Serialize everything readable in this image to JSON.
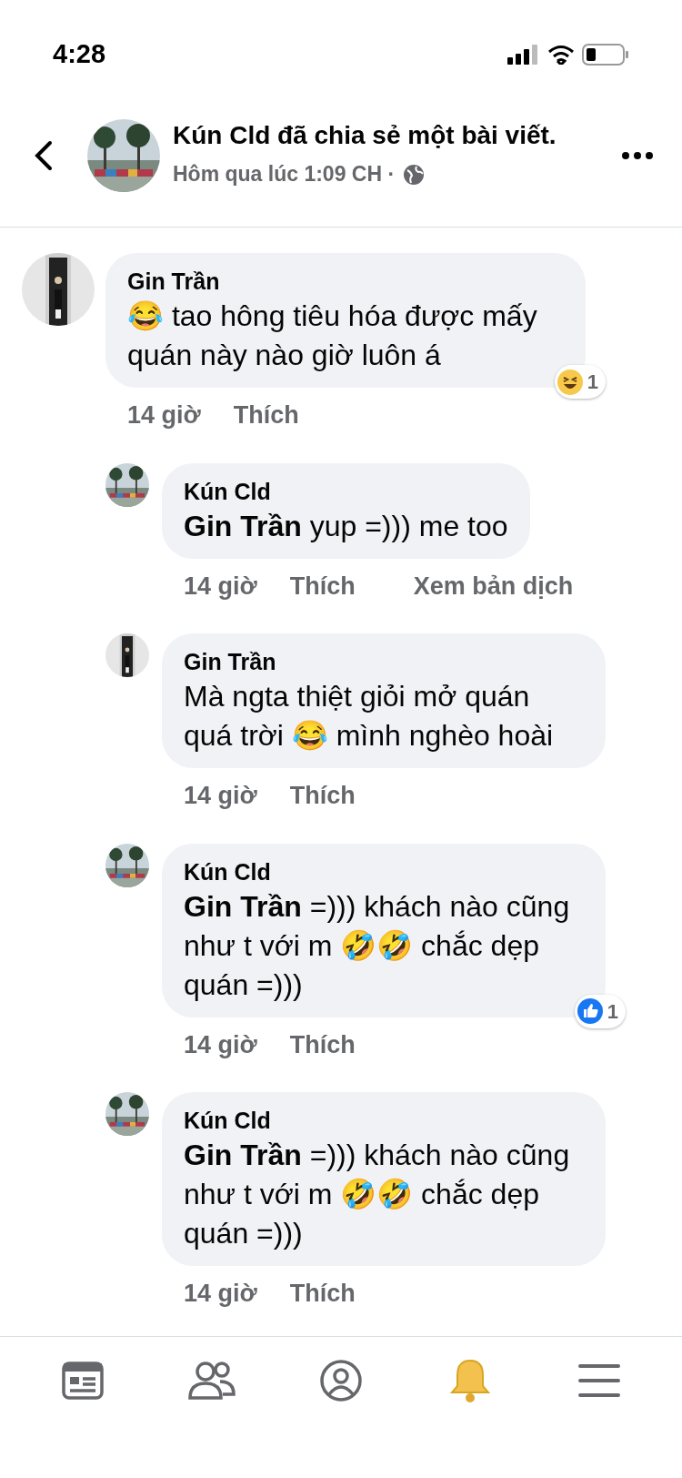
{
  "status_bar": {
    "time": "4:28"
  },
  "header": {
    "title": "Kún Cld đã chia sẻ một bài viết.",
    "subtitle": "Hôm qua lúc 1:09 CH ·",
    "avatar": {
      "kind": "palms"
    }
  },
  "comments": [
    {
      "author": "Gin Trần",
      "avatar": {
        "kind": "person"
      },
      "text": "😂 tao hông tiêu hóa được mấy quán này nào giờ luôn á",
      "time": "14 giờ",
      "like": "Thích",
      "reaction": {
        "kind": "haha",
        "count": "1"
      },
      "replies": [
        {
          "author": "Kún Cld",
          "avatar": {
            "kind": "palms"
          },
          "text": "**Gin Trần**  yup =))) me too",
          "time": "14 giờ",
          "like": "Thích",
          "translate": "Xem bản dịch"
        },
        {
          "author": "Gin Trần",
          "avatar": {
            "kind": "person"
          },
          "text": "Mà ngta thiệt giỏi mở quán quá trời 😂 mình nghèo hoài",
          "time": "14 giờ",
          "like": "Thích"
        },
        {
          "author": "Kún Cld",
          "avatar": {
            "kind": "palms"
          },
          "text": "**Gin Trần**  =))) khách nào cũng như t với m 🤣🤣 chắc dẹp quán =)))",
          "time": "14 giờ",
          "like": "Thích",
          "reaction": {
            "kind": "like",
            "count": "1"
          }
        },
        {
          "author": "Kún Cld",
          "avatar": {
            "kind": "palms"
          },
          "text": "**Gin Trần**  =))) khách nào cũng như t với m 🤣🤣 chắc dẹp quán =)))",
          "time": "14 giờ",
          "like": "Thích"
        }
      ]
    }
  ],
  "tab_bar": [
    {
      "kind": "feed"
    },
    {
      "kind": "friends"
    },
    {
      "kind": "profile"
    },
    {
      "kind": "notifications"
    },
    {
      "kind": "menu"
    }
  ]
}
